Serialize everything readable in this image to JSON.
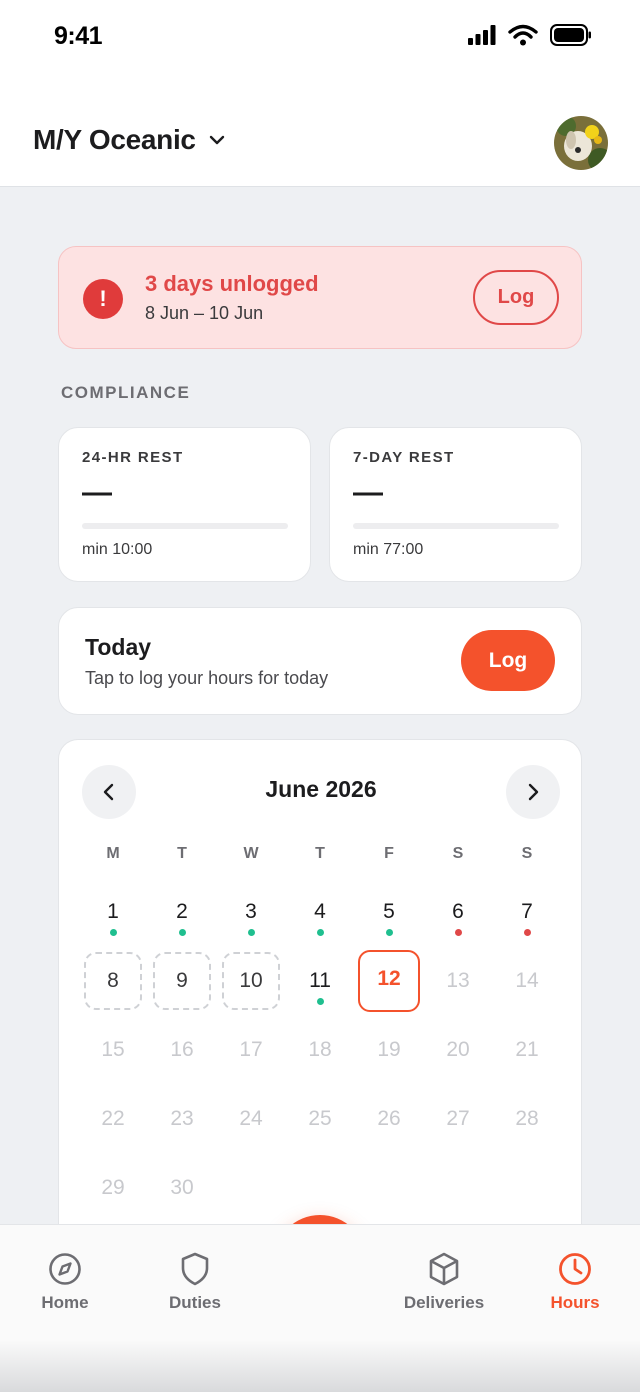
{
  "status_bar": {
    "time": "9:41"
  },
  "header": {
    "vessel_name": "M/Y Oceanic"
  },
  "alert": {
    "title": "3 days unlogged",
    "range": "8 Jun – 10 Jun",
    "button": "Log"
  },
  "compliance": {
    "section_label": "COMPLIANCE",
    "cards": [
      {
        "label": "24-HR REST",
        "value": "—",
        "min": "min 10:00",
        "progress": 0
      },
      {
        "label": "7-DAY REST",
        "value": "—",
        "min": "min 77:00",
        "progress": 0
      }
    ]
  },
  "today": {
    "title": "Today",
    "subtitle": "Tap to log your hours for today",
    "button": "Log"
  },
  "calendar": {
    "month": "June 2026",
    "weekdays": [
      "M",
      "T",
      "W",
      "T",
      "F",
      "S",
      "S"
    ],
    "days": [
      {
        "n": "1",
        "state": "logged",
        "dot": "#1fbf8f"
      },
      {
        "n": "2",
        "state": "logged",
        "dot": "#1fbf8f"
      },
      {
        "n": "3",
        "state": "logged",
        "dot": "#1fbf8f"
      },
      {
        "n": "4",
        "state": "logged",
        "dot": "#1fbf8f"
      },
      {
        "n": "5",
        "state": "logged",
        "dot": "#1fbf8f"
      },
      {
        "n": "6",
        "state": "logged",
        "dot": "#e04848"
      },
      {
        "n": "7",
        "state": "logged",
        "dot": "#e04848"
      },
      {
        "n": "8",
        "state": "unlogged"
      },
      {
        "n": "9",
        "state": "unlogged"
      },
      {
        "n": "10",
        "state": "unlogged"
      },
      {
        "n": "11",
        "state": "logged",
        "dot": "#1fbf8f"
      },
      {
        "n": "12",
        "state": "today"
      },
      {
        "n": "13",
        "state": "future"
      },
      {
        "n": "14",
        "state": "future"
      },
      {
        "n": "15",
        "state": "future"
      },
      {
        "n": "16",
        "state": "future"
      },
      {
        "n": "17",
        "state": "future"
      },
      {
        "n": "18",
        "state": "future"
      },
      {
        "n": "19",
        "state": "future"
      },
      {
        "n": "20",
        "state": "future"
      },
      {
        "n": "21",
        "state": "future"
      },
      {
        "n": "22",
        "state": "future"
      },
      {
        "n": "23",
        "state": "future"
      },
      {
        "n": "24",
        "state": "future"
      },
      {
        "n": "25",
        "state": "future"
      },
      {
        "n": "26",
        "state": "future"
      },
      {
        "n": "27",
        "state": "future"
      },
      {
        "n": "28",
        "state": "future"
      },
      {
        "n": "29",
        "state": "future"
      },
      {
        "n": "30",
        "state": "future"
      }
    ]
  },
  "tabs": [
    {
      "label": "Home",
      "icon": "compass-icon",
      "active": false
    },
    {
      "label": "Duties",
      "icon": "shield-icon",
      "active": false
    },
    {
      "label": "Deliveries",
      "icon": "box-icon",
      "active": false
    },
    {
      "label": "Hours",
      "icon": "clock-icon",
      "active": true
    }
  ],
  "colors": {
    "accent": "#f4522c",
    "alert_red": "#e04848",
    "logged_dot": "#1fbf8f"
  }
}
